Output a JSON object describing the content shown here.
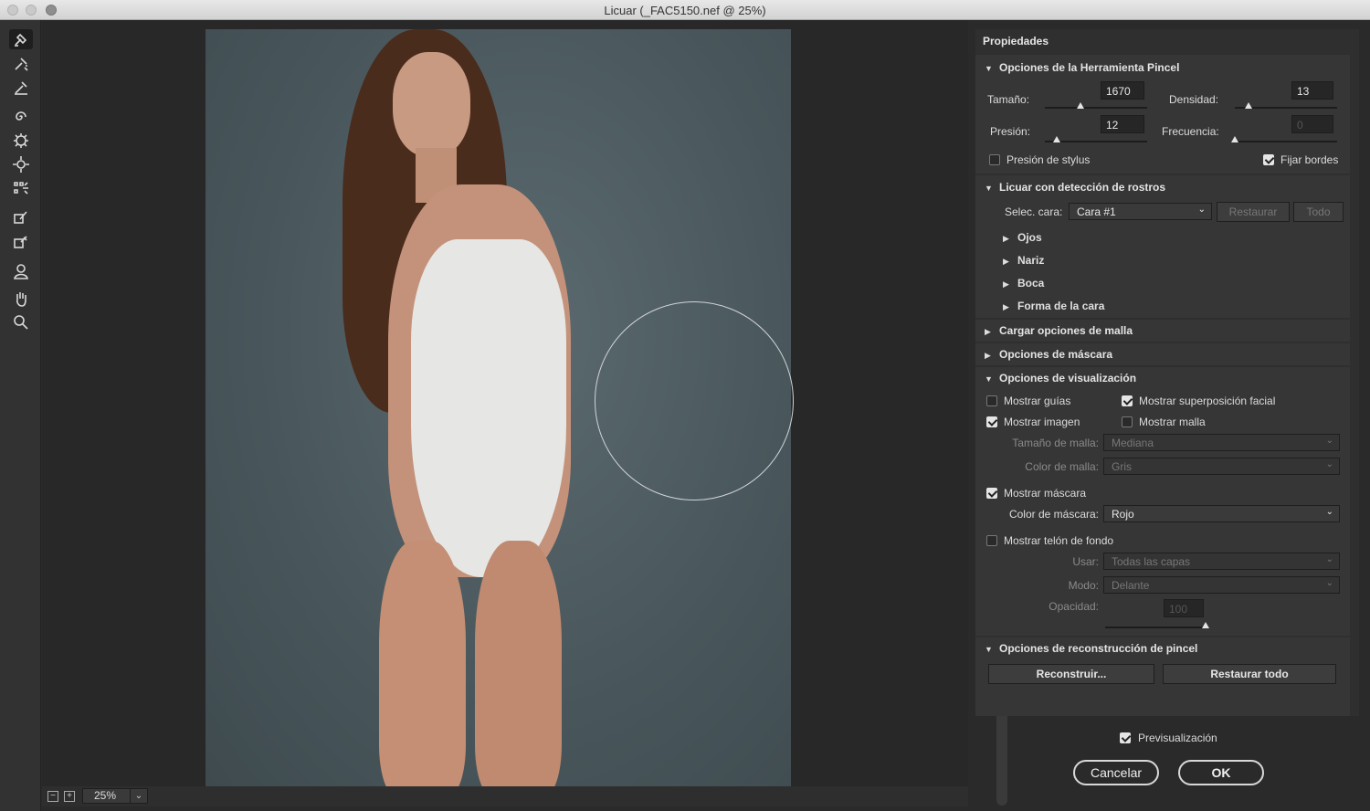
{
  "window": {
    "title": "Licuar (_FAC5150.nef @ 25%)"
  },
  "tools": [
    "forward-warp-icon",
    "reconstruct-icon",
    "smooth-icon",
    "twirl-icon",
    "pucker-icon",
    "bloat-icon",
    "push-left-icon",
    "freeze-mask-icon",
    "thaw-mask-icon",
    "face-tool-icon",
    "hand-icon",
    "zoom-icon"
  ],
  "status": {
    "zoom": "25%"
  },
  "panel": {
    "title": "Propiedades",
    "brush": {
      "title": "Opciones de la Herramienta Pincel",
      "size_label": "Tamaño:",
      "size": "1670",
      "size_level": 0.35,
      "density_label": "Densidad:",
      "density": "13",
      "density_level": 0.13,
      "pressure_label": "Presión:",
      "pressure": "12",
      "pressure_level": 0.12,
      "rate_label": "Frecuencia:",
      "rate": "0",
      "rate_level": 0.0,
      "stylus_label": "Presión de stylus",
      "stylus": false,
      "pin_label": "Fijar bordes",
      "pin": true
    },
    "face": {
      "title": "Licuar con detección de rostros",
      "select_label": "Selec. cara:",
      "select_value": "Cara #1",
      "reset_label": "Restaurar",
      "all_label": "Todo",
      "items": [
        "Ojos",
        "Nariz",
        "Boca",
        "Forma de la cara"
      ]
    },
    "mesh_title": "Cargar opciones de malla",
    "mask_title": "Opciones de máscara",
    "view": {
      "title": "Opciones de visualización",
      "guides": "Mostrar guías",
      "overlay": "Mostrar superposición facial",
      "image": "Mostrar imagen",
      "mesh": "Mostrar malla",
      "mesh_size_label": "Tamaño de malla:",
      "mesh_size": "Mediana",
      "mesh_color_label": "Color de malla:",
      "mesh_color": "Gris",
      "mask": "Mostrar máscara",
      "mask_color_label": "Color de máscara:",
      "mask_color": "Rojo",
      "backdrop": "Mostrar telón de fondo",
      "use_label": "Usar:",
      "use": "Todas las capas",
      "mode_label": "Modo:",
      "mode": "Delante",
      "opacity_label": "Opacidad:",
      "opacity": "100",
      "opacity_level": 1.0
    },
    "reconstruct": {
      "title": "Opciones de reconstrucción de pincel",
      "reconstruct_label": "Reconstruir...",
      "restore_all_label": "Restaurar todo"
    }
  },
  "footer": {
    "preview_label": "Previsualización",
    "cancel": "Cancelar",
    "ok": "OK"
  }
}
